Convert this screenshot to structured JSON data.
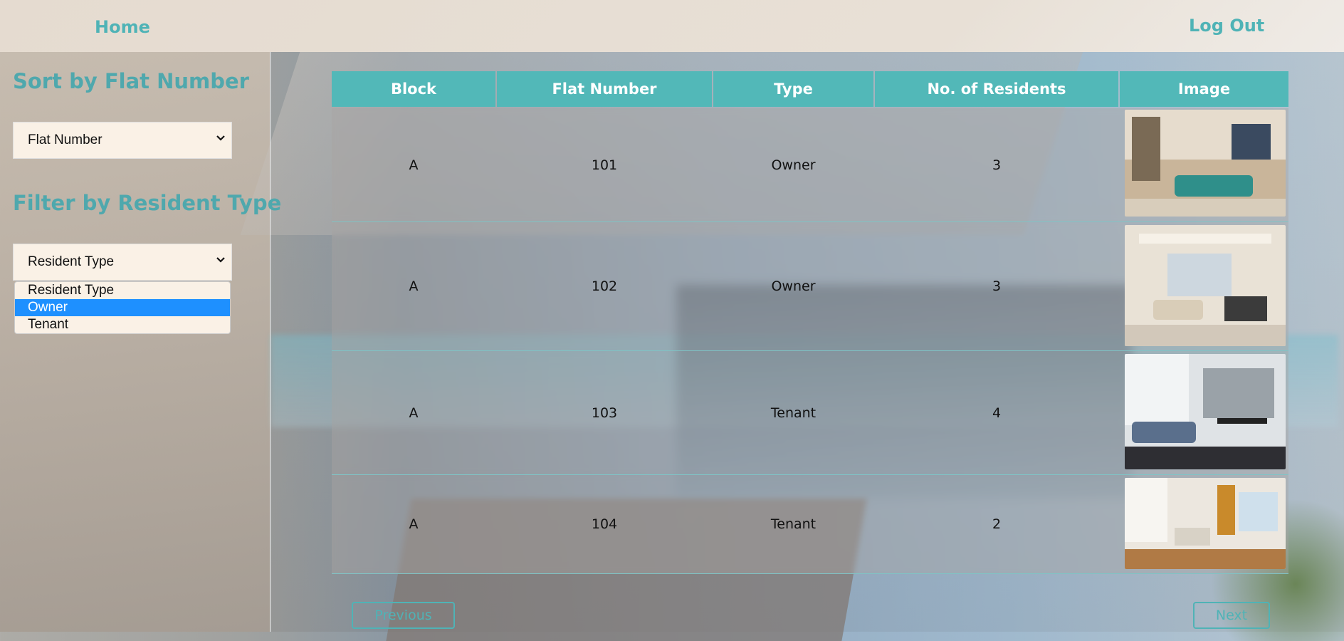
{
  "nav": {
    "home_label": "Home",
    "logout_label": "Log Out"
  },
  "sidebar": {
    "sort_title": "Sort by Flat Number",
    "sort_select_value": "Flat Number",
    "filter_title": "Filter by Resident Type",
    "filter_select_value": "Resident Type",
    "filter_options": [
      "Resident Type",
      "Owner",
      "Tenant"
    ],
    "filter_highlighted": "Owner"
  },
  "table": {
    "headers": [
      "Block",
      "Flat Number",
      "Type",
      "No. of Residents",
      "Image"
    ],
    "rows": [
      {
        "block": "A",
        "flat": "101",
        "type": "Owner",
        "residents": "3",
        "image": "living-room-teal-sofa"
      },
      {
        "block": "A",
        "flat": "102",
        "type": "Owner",
        "residents": "3",
        "image": "living-room-cream"
      },
      {
        "block": "A",
        "flat": "103",
        "type": "Tenant",
        "residents": "4",
        "image": "living-room-grey-modern"
      },
      {
        "block": "A",
        "flat": "104",
        "type": "Tenant",
        "residents": "2",
        "image": "kitchen-dining-room"
      }
    ]
  },
  "pagination": {
    "previous_label": "Previous",
    "next_label": "Next"
  },
  "colors": {
    "accent": "#52b8b8",
    "select_bg": "#faf1e6",
    "option_highlight": "#1e90ff"
  }
}
